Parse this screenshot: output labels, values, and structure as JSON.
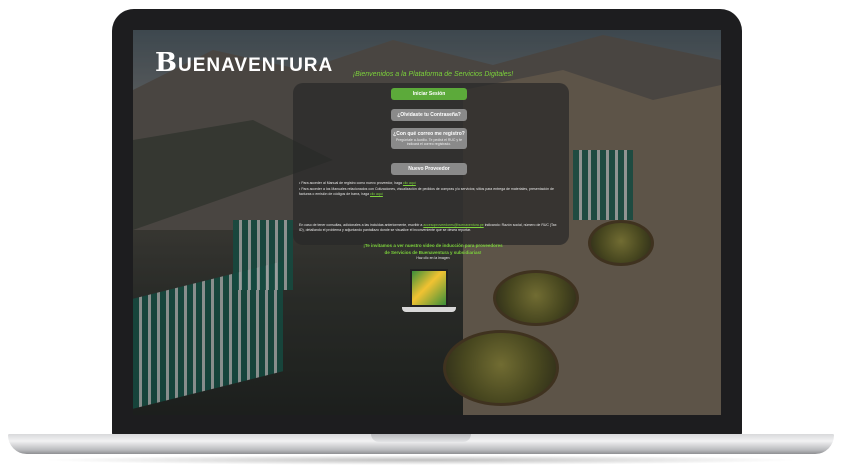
{
  "brand": {
    "logo_initial": "B",
    "logo_rest": "UENAVENTURA"
  },
  "welcome": "¡Bienvenidos a la Plataforma de Servicios Digitales!",
  "buttons": {
    "login": "Iniciar Sesión",
    "forgot": "¿Olvidaste tu Contraseña?",
    "which_email": "¿Con qué correo me registro?",
    "which_email_sub": "Pregúntale a Auxilio. Te pedirá el RUC y te indicará el correo registrado.",
    "new_supplier": "Nuevo Proveedor"
  },
  "bullets": [
    {
      "text": "Para acceder al Manual de registro como nuevo proveedor, haga",
      "link": "clic aquí"
    },
    {
      "text": "Para acceder a los Manuales relacionados con Cotizaciones, visualización de pedidos de compras y/o servicios; sitios para entrega de materiales, presentación de facturas o emisión de códigos de barra, haga",
      "link": "clic aquí"
    }
  ],
  "support": {
    "text": "En caso de tener consultas, adicionales a las incluidas anteriormente, escribir a",
    "email": "accesoproveedores@buenaventura.pe",
    "rest": "indicando: Razón social, número de RUC (Tax ID), detallando el problema y adjuntando pantallazo donde se visualice el inconveniente que se desea reportar."
  },
  "promo": {
    "line1": "¡Te invitamos a ver nuestro video de inducción para proveedores",
    "line2": "de Servicios de Buenaventura y subsidiarias!",
    "hint": "Haz clic en la imagen"
  },
  "colors": {
    "accent": "#5caa3a",
    "accent_text": "#7cd33b",
    "panel": "#282828"
  }
}
